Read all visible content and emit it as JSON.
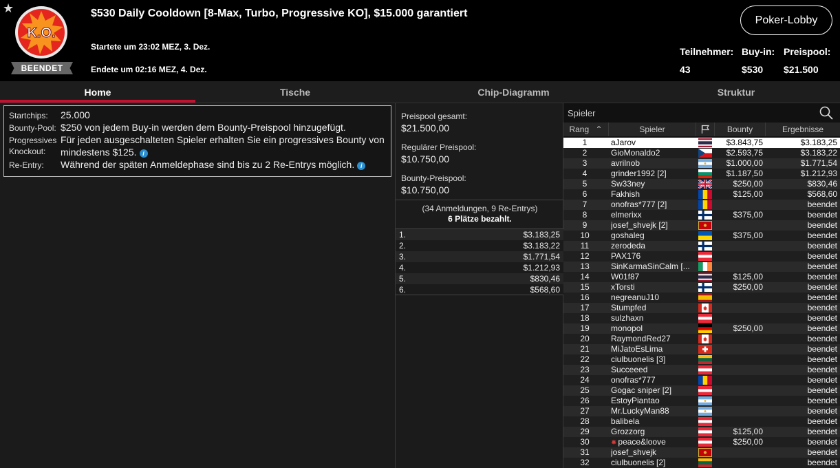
{
  "header": {
    "title": "$530 Daily Cooldown [8-Max, Turbo, Progressive KO], $15.000 garantiert",
    "badge_text": "K.O.",
    "status": "BEENDET",
    "started": "Startete um 23:02 MEZ, 3. Dez.",
    "ended": "Endete um 02:16 MEZ, 4. Dez.",
    "lobby_button": "Poker-Lobby",
    "stats": [
      {
        "label": "Teilnehmer:",
        "value": "43"
      },
      {
        "label": "Buy-in:",
        "value": "$530"
      },
      {
        "label": "Preispool:",
        "value": "$21.500"
      }
    ]
  },
  "tabs": [
    "Home",
    "Tische",
    "Chip-Diagramm",
    "Struktur"
  ],
  "info": {
    "startchips_label": "Startchips:",
    "startchips_value": "25.000",
    "bountypool_label": "Bounty-Pool:",
    "bountypool_value": "$250 von jedem Buy-in werden dem Bounty-Preispool hinzugefügt.",
    "progressive_label": "Progressives Knockout:",
    "progressive_value": "Für jeden ausgeschalteten Spieler erhalten Sie ein progressives Bounty von mindestens $125.",
    "reentry_label": "Re-Entry:",
    "reentry_value": "Während der späten Anmeldephase sind bis zu 2 Re-Entrys möglich.",
    "info_glyph": "i"
  },
  "prize": {
    "total_label": "Preispool gesamt:",
    "total_value": "$21.500,00",
    "regular_label": "Regulärer Preispool:",
    "regular_value": "$10.750,00",
    "bounty_label": "Bounty-Preispool:",
    "bounty_value": "$10.750,00",
    "registrations": "(34 Anmeldungen, 9 Re-Entrys)",
    "places_paid": "6 Plätze bezahlt.",
    "payouts": [
      {
        "place": "1.",
        "amount": "$3.183,25"
      },
      {
        "place": "2.",
        "amount": "$3.183,22"
      },
      {
        "place": "3.",
        "amount": "$1.771,54"
      },
      {
        "place": "4.",
        "amount": "$1.212,93"
      },
      {
        "place": "5.",
        "amount": "$830,46"
      },
      {
        "place": "6.",
        "amount": "$568,60"
      }
    ]
  },
  "players": {
    "search_placeholder": "Spieler",
    "columns": {
      "rank": "Rang",
      "player": "Spieler",
      "bounty": "Bounty",
      "results": "Ergebnisse"
    },
    "rows": [
      {
        "rank": "1",
        "name": "aJarov",
        "flag": "thai",
        "bounty": "$3.843,75",
        "result": "$3.183,25"
      },
      {
        "rank": "2",
        "name": "GioMonaldo2",
        "flag": "czech",
        "bounty": "$2.593,75",
        "result": "$3.183,22"
      },
      {
        "rank": "3",
        "name": "avrilnob",
        "flag": "argentina",
        "bounty": "$1.000,00",
        "result": "$1.771,54"
      },
      {
        "rank": "4",
        "name": "grinder1992 [2]",
        "flag": "bulgaria",
        "bounty": "$1.187,50",
        "result": "$1.212,93"
      },
      {
        "rank": "5",
        "name": "Sw33ney",
        "flag": "uk",
        "bounty": "$250,00",
        "result": "$830,46"
      },
      {
        "rank": "6",
        "name": "Fakhish",
        "flag": "moldova",
        "bounty": "$125,00",
        "result": "$568,60"
      },
      {
        "rank": "7",
        "name": "onofras*777 [2]",
        "flag": "moldova",
        "bounty": "",
        "result": "beendet"
      },
      {
        "rank": "8",
        "name": "elmerixx",
        "flag": "finland",
        "bounty": "$375,00",
        "result": "beendet"
      },
      {
        "rank": "9",
        "name": "josef_shvejk [2]",
        "flag": "montenegro",
        "bounty": "",
        "result": "beendet"
      },
      {
        "rank": "10",
        "name": "goshaleg",
        "flag": "ukraine",
        "bounty": "$375,00",
        "result": "beendet"
      },
      {
        "rank": "11",
        "name": "zerodeda",
        "flag": "finland",
        "bounty": "",
        "result": "beendet"
      },
      {
        "rank": "12",
        "name": "PAX176",
        "flag": "austria",
        "bounty": "",
        "result": "beendet"
      },
      {
        "rank": "13",
        "name": "SinKarmaSinCalm [...",
        "flag": "ireland",
        "bounty": "",
        "result": "beendet"
      },
      {
        "rank": "14",
        "name": "W01f87",
        "flag": "thai",
        "bounty": "$125,00",
        "result": "beendet"
      },
      {
        "rank": "15",
        "name": "xTorsti",
        "flag": "finland",
        "bounty": "$250,00",
        "result": "beendet"
      },
      {
        "rank": "16",
        "name": "negreanuJ10",
        "flag": "spain",
        "bounty": "",
        "result": "beendet"
      },
      {
        "rank": "17",
        "name": "Stumpfed",
        "flag": "canada",
        "bounty": "",
        "result": "beendet"
      },
      {
        "rank": "18",
        "name": "sulzhaxn",
        "flag": "austria",
        "bounty": "",
        "result": "beendet"
      },
      {
        "rank": "19",
        "name": "monopol",
        "flag": "germany",
        "bounty": "$250,00",
        "result": "beendet"
      },
      {
        "rank": "20",
        "name": "RaymondRed27",
        "flag": "canada",
        "bounty": "",
        "result": "beendet"
      },
      {
        "rank": "21",
        "name": "MiJatoEsLima",
        "flag": "swiss",
        "bounty": "",
        "result": "beendet"
      },
      {
        "rank": "22",
        "name": "ciulbuonelis [3]",
        "flag": "lithuania",
        "bounty": "",
        "result": "beendet"
      },
      {
        "rank": "23",
        "name": "Succeeed",
        "flag": "austria",
        "bounty": "",
        "result": "beendet"
      },
      {
        "rank": "24",
        "name": "onofras*777",
        "flag": "moldova",
        "bounty": "",
        "result": "beendet"
      },
      {
        "rank": "25",
        "name": "Gogac sniper [2]",
        "flag": "austria",
        "bounty": "",
        "result": "beendet"
      },
      {
        "rank": "26",
        "name": "EstoyPiantao",
        "flag": "argentina",
        "bounty": "",
        "result": "beendet"
      },
      {
        "rank": "27",
        "name": "Mr.LuckyMan88",
        "flag": "argentina",
        "bounty": "",
        "result": "beendet"
      },
      {
        "rank": "28",
        "name": "balibela",
        "flag": "austria",
        "bounty": "",
        "result": "beendet"
      },
      {
        "rank": "29",
        "name": "Grozzorg",
        "flag": "austria",
        "bounty": "$125,00",
        "result": "beendet"
      },
      {
        "rank": "30",
        "name": "peace&loove",
        "flag": "austria",
        "bounty": "$250,00",
        "result": "beendet",
        "star": true
      },
      {
        "rank": "31",
        "name": "josef_shvejk",
        "flag": "montenegro",
        "bounty": "",
        "result": "beendet"
      },
      {
        "rank": "32",
        "name": "ciulbuonelis [2]",
        "flag": "lithuania",
        "bounty": "",
        "result": "beendet"
      }
    ]
  },
  "colors": {
    "accent": "#c5102f",
    "badge_red": "#e4261f",
    "badge_orange": "#f7931e",
    "info_blue": "#2a8fd1"
  }
}
